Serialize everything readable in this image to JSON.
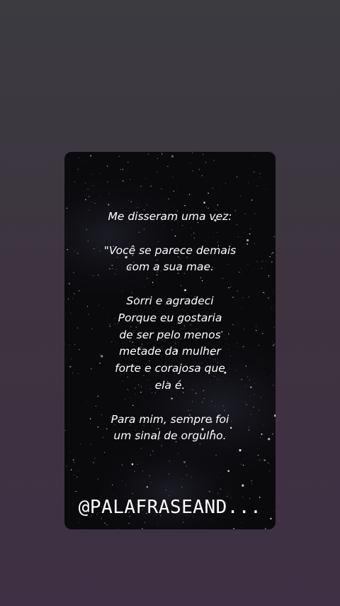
{
  "story": {
    "lines": [
      "Me disseram uma vez:",
      "",
      "\"Você se parece demais",
      "com a sua mae.",
      "",
      "Sorri e agradeci",
      "Porque eu gostaria",
      "de ser pelo menos",
      "metade da mulher",
      "forte e corajosa que",
      "ela é.",
      "",
      "Para mim, sempre foi",
      "um sinal de orgulho."
    ],
    "handle": "@PALAFRASEAND..."
  },
  "colors": {
    "background_top": "#3b3b40",
    "background_bottom": "#3f3045",
    "card_background": "#0a0a0d",
    "text": "#ffffff"
  }
}
